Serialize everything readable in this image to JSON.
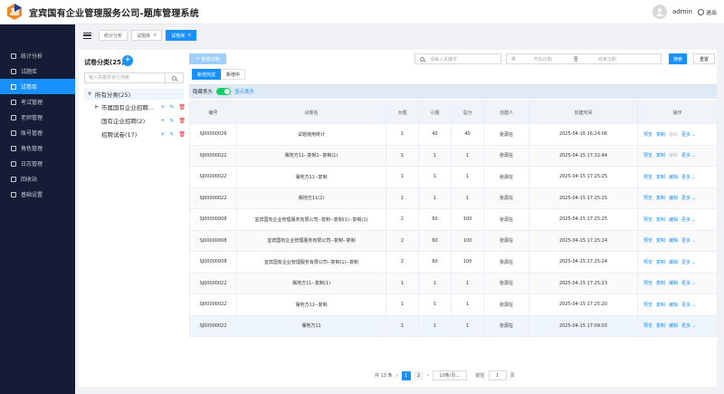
{
  "app": {
    "title": "宜宾国有企业管理服务公司-题库管理系统"
  },
  "user": {
    "name": "admin",
    "logout_label": "退出"
  },
  "sidebar": {
    "items": [
      {
        "label": "统计分析",
        "icon": "chart-icon",
        "active": false
      },
      {
        "label": "试题库",
        "icon": "database-icon",
        "active": false
      },
      {
        "label": "试卷库",
        "icon": "folder-icon",
        "active": true
      },
      {
        "label": "考试管理",
        "icon": "exam-icon",
        "active": false
      },
      {
        "label": "老师管理",
        "icon": "teacher-icon",
        "active": false
      },
      {
        "label": "账号管理",
        "icon": "account-icon",
        "active": false
      },
      {
        "label": "角色管理",
        "icon": "role-icon",
        "active": false
      },
      {
        "label": "日志管理",
        "icon": "log-icon",
        "active": false
      },
      {
        "label": "回收站",
        "icon": "recycle-icon",
        "active": false
      },
      {
        "label": "基础设置",
        "icon": "settings-icon",
        "active": false
      }
    ]
  },
  "tabs": [
    {
      "label": "统计分析",
      "closable": false,
      "active": false
    },
    {
      "label": "试题库",
      "closable": true,
      "active": false
    },
    {
      "label": "试卷库",
      "closable": true,
      "active": true
    }
  ],
  "left": {
    "title": "试卷分类(25)",
    "search_placeholder": "输入关键字进行搜索",
    "root": "所有分类(25)",
    "nodes": [
      {
        "label": "市属国有企业招聘..."
      },
      {
        "label": "国有企业招聘(2)"
      },
      {
        "label": "招聘试卷(17)"
      }
    ]
  },
  "toolbar": {
    "new_label": "新增试卷",
    "keyword_placeholder": "请输入关键字",
    "start_placeholder": "开始日期",
    "range_sep": "至",
    "end_placeholder": "结束日期",
    "search_label": "搜索",
    "reset_label": "重置"
  },
  "status_tabs": [
    "新增完成",
    "新增中"
  ],
  "toggle": {
    "hide_label": "隐藏表头",
    "show_label": "显示表头"
  },
  "table": {
    "headers": [
      "编号",
      "试卷名",
      "大题",
      "小题",
      "总分",
      "创建人",
      "创建时间",
      "操作"
    ],
    "rows": [
      {
        "code": "SJ00000026",
        "name": "试题使用统计",
        "big": "1",
        "small": "40",
        "score": "40",
        "creator": "张源在",
        "time": "2025-04-16 16:24:06",
        "edit_disabled": true
      },
      {
        "code": "SJ00000022",
        "name": "儒地方11--复制1--复制(1)",
        "big": "1",
        "small": "1",
        "score": "1",
        "creator": "张源在",
        "time": "2025-04-15 17:32:44",
        "edit_disabled": true
      },
      {
        "code": "SJ00000022",
        "name": "儒地方11--复制",
        "big": "1",
        "small": "1",
        "score": "1",
        "creator": "张源在",
        "time": "2025-04-15 17:25:25",
        "edit_disabled": false
      },
      {
        "code": "SJ00000022",
        "name": "儒地方11(2)",
        "big": "1",
        "small": "1",
        "score": "1",
        "creator": "张源在",
        "time": "2025-04-15 17:25:25",
        "edit_disabled": false
      },
      {
        "code": "SJ00000008",
        "name": "宜宾国有企业管理服务有限公司--复制--复制(1)--复制(1)",
        "big": "2",
        "small": "60",
        "score": "100",
        "creator": "张源在",
        "time": "2025-04-15 17:25:25",
        "edit_disabled": false
      },
      {
        "code": "SJ00000008",
        "name": "宜宾国有企业管理服务有限公司--复制--复制",
        "big": "2",
        "small": "60",
        "score": "100",
        "creator": "张源在",
        "time": "2025-04-15 17:25:24",
        "edit_disabled": false
      },
      {
        "code": "SJ00000008",
        "name": "宜宾国有企业管理服务有限公司--复制(1)--复制",
        "big": "2",
        "small": "60",
        "score": "100",
        "creator": "张源在",
        "time": "2025-04-15 17:25:24",
        "edit_disabled": false
      },
      {
        "code": "SJ00000022",
        "name": "儒地方11--复制(1)",
        "big": "1",
        "small": "1",
        "score": "1",
        "creator": "张源在",
        "time": "2025-04-15 17:25:23",
        "edit_disabled": false
      },
      {
        "code": "SJ00000022",
        "name": "儒地方11--复制",
        "big": "1",
        "small": "1",
        "score": "1",
        "creator": "张源在",
        "time": "2025-04-15 17:25:20",
        "edit_disabled": false
      },
      {
        "code": "SJ00000022",
        "name": "儒地方11",
        "big": "1",
        "small": "1",
        "score": "1",
        "creator": "张源在",
        "time": "2025-04-15 17:09:03",
        "edit_disabled": false
      }
    ],
    "ops": {
      "preview": "预览",
      "copy": "复制",
      "edit": "编辑",
      "more": "更多"
    }
  },
  "pager": {
    "total": "共 13 条",
    "pages": [
      "1",
      "2"
    ],
    "current": "1",
    "size": "10条/页",
    "goto_label": "前往",
    "goto_value": "1",
    "page_suffix": "页"
  },
  "colors": {
    "primary": "#1890ff",
    "sidebar": "#141d35",
    "danger": "#f5222d",
    "switch_on": "#13ce66"
  }
}
